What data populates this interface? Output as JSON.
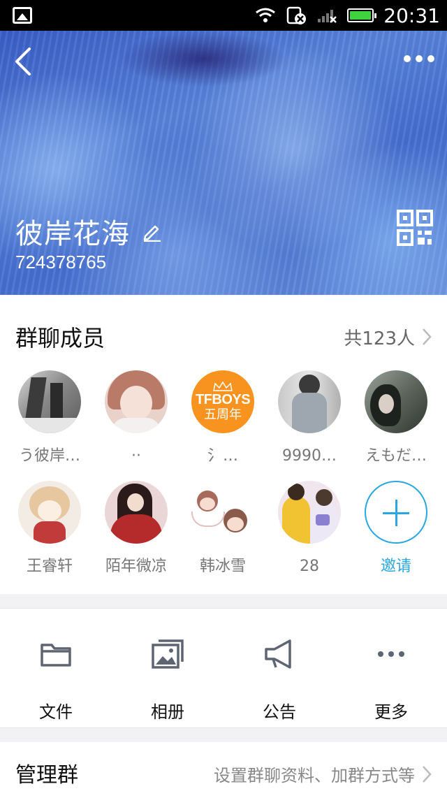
{
  "status_bar": {
    "time": "20:31"
  },
  "header": {
    "group_name": "彼岸花海",
    "group_id": "724378765"
  },
  "members": {
    "title": "群聊成员",
    "count_label": "共123人",
    "items": [
      {
        "name": "う彼岸…",
        "avatar": "photo-street",
        "colors": [
          "#6a6a6a",
          "#d9d9d9"
        ]
      },
      {
        "name": "··",
        "avatar": "photo-girl",
        "colors": [
          "#c88a7a",
          "#f3e2dc"
        ]
      },
      {
        "name": "氵…",
        "avatar": "tfboys-badge",
        "text": "TFBOYS\n五周年",
        "colors": [
          "#f7931e",
          "#ffffff"
        ]
      },
      {
        "name": "9990…",
        "avatar": "photo-boy",
        "colors": [
          "#8a8a8a",
          "#e6e6e6"
        ]
      },
      {
        "name": "えもだ…",
        "avatar": "photo-dark",
        "colors": [
          "#3a3f3a",
          "#9aa39a"
        ]
      },
      {
        "name": "王睿轩",
        "avatar": "cartoon-girl",
        "colors": [
          "#e7c7a0",
          "#c23b3b"
        ]
      },
      {
        "name": "陌年微凉",
        "avatar": "anime-red",
        "colors": [
          "#b52a2a",
          "#e8d0d0"
        ]
      },
      {
        "name": "韩冰雪",
        "avatar": "anime-chibi",
        "colors": [
          "#f0e0d8",
          "#a86a5a"
        ]
      },
      {
        "name": "28",
        "avatar": "photo-friends",
        "colors": [
          "#f1c232",
          "#8a7fd0"
        ]
      }
    ],
    "invite_label": "邀请"
  },
  "actions": [
    {
      "label": "文件",
      "icon": "folder-icon"
    },
    {
      "label": "相册",
      "icon": "album-icon"
    },
    {
      "label": "公告",
      "icon": "megaphone-icon"
    },
    {
      "label": "更多",
      "icon": "more-dots-icon"
    }
  ],
  "manage": {
    "title": "管理群",
    "desc": "设置群聊资料、加群方式等"
  },
  "colors": {
    "accent": "#2aa6e0",
    "banner": "#4670d0"
  }
}
